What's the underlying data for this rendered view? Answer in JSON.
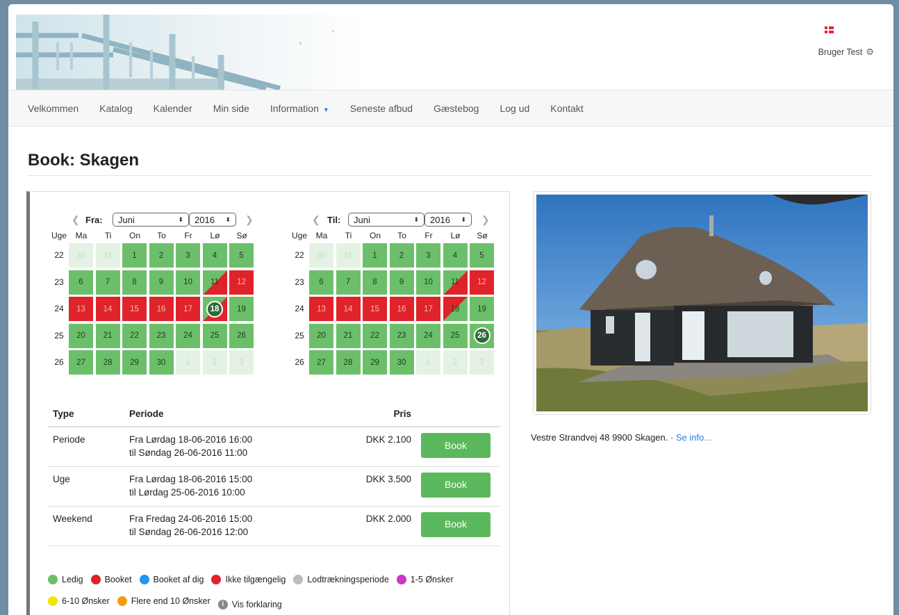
{
  "header": {
    "user_label": "Bruger Test",
    "flag_icon": "danish-flag-icon",
    "settings_icon": "gear-icon"
  },
  "nav": {
    "items": [
      "Velkommen",
      "Katalog",
      "Kalender",
      "Min side",
      "Information",
      "Seneste afbud",
      "Gæstebog",
      "Log ud",
      "Kontakt"
    ]
  },
  "page": {
    "title": "Book: Skagen"
  },
  "calendar_from": {
    "label": "Fra:",
    "month": "Juni",
    "year": "2016",
    "week_label": "Uge"
  },
  "calendar_to": {
    "label": "Til:",
    "month": "Juni",
    "year": "2016",
    "week_label": "Uge"
  },
  "weekdays": [
    "Ma",
    "Ti",
    "On",
    "To",
    "Fr",
    "Lø",
    "Sø"
  ],
  "weeks": [
    "22",
    "23",
    "24",
    "25",
    "26"
  ],
  "days": [
    [
      "30",
      "31",
      "1",
      "2",
      "3",
      "4",
      "5"
    ],
    [
      "6",
      "7",
      "8",
      "9",
      "10",
      "11",
      "12"
    ],
    [
      "13",
      "14",
      "15",
      "16",
      "17",
      "18",
      "19"
    ],
    [
      "20",
      "21",
      "22",
      "23",
      "24",
      "25",
      "26"
    ],
    [
      "27",
      "28",
      "29",
      "30",
      "1",
      "2",
      "3"
    ]
  ],
  "states_from": [
    [
      "f",
      "f",
      "g",
      "g",
      "g",
      "g",
      "g"
    ],
    [
      "g",
      "g",
      "g",
      "g",
      "g",
      "half",
      "r"
    ],
    [
      "r",
      "r",
      "r",
      "r",
      "r",
      "sel",
      "g"
    ],
    [
      "g",
      "g",
      "g",
      "g",
      "g",
      "g",
      "g"
    ],
    [
      "g",
      "g",
      "g",
      "g",
      "f",
      "f",
      "f"
    ]
  ],
  "states_to": [
    [
      "f",
      "f",
      "g",
      "g",
      "g",
      "g",
      "g"
    ],
    [
      "g",
      "g",
      "g",
      "g",
      "g",
      "half",
      "r"
    ],
    [
      "r",
      "r",
      "r",
      "r",
      "r",
      "halfr",
      "g"
    ],
    [
      "g",
      "g",
      "g",
      "g",
      "g",
      "g",
      "sel"
    ],
    [
      "g",
      "g",
      "g",
      "g",
      "f",
      "f",
      "f"
    ]
  ],
  "table": {
    "headers": {
      "type": "Type",
      "period": "Periode",
      "price": "Pris"
    },
    "rows": [
      {
        "type": "Periode",
        "from": "Fra Lørdag 18-06-2016 16:00",
        "to": "til Søndag 26-06-2016 11:00",
        "price": "DKK 2.100",
        "button": "Book"
      },
      {
        "type": "Uge",
        "from": "Fra Lørdag 18-06-2016 15:00",
        "to": "til Lørdag 25-06-2016 10:00",
        "price": "DKK 3.500",
        "button": "Book"
      },
      {
        "type": "Weekend",
        "from": "Fra Fredag 24-06-2016 15:00",
        "to": "til Søndag 26-06-2016 12:00",
        "price": "DKK 2.000",
        "button": "Book"
      }
    ]
  },
  "legend": [
    {
      "label": "Ledig",
      "color": "#6cbf6a"
    },
    {
      "label": "Booket",
      "color": "#e0232b"
    },
    {
      "label": "Booket af dig",
      "color": "#2196f3"
    },
    {
      "label": "Ikke tilgængelig",
      "color": "#e0232b"
    },
    {
      "label": "Lodtrækningsperiode",
      "color": "#bdbdbd"
    },
    {
      "label": "1-5 Ønsker",
      "color": "#c837c8"
    },
    {
      "label": "6-10 Ønsker",
      "color": "#f5e600"
    },
    {
      "label": "Flere end 10 Ønsker",
      "color": "#f39c12"
    },
    {
      "label": "Vis forklaring",
      "color": "info"
    }
  ],
  "property": {
    "address": "Vestre Strandvej 48 9900 Skagen.",
    "separator": " · ",
    "link": "Se info..."
  }
}
